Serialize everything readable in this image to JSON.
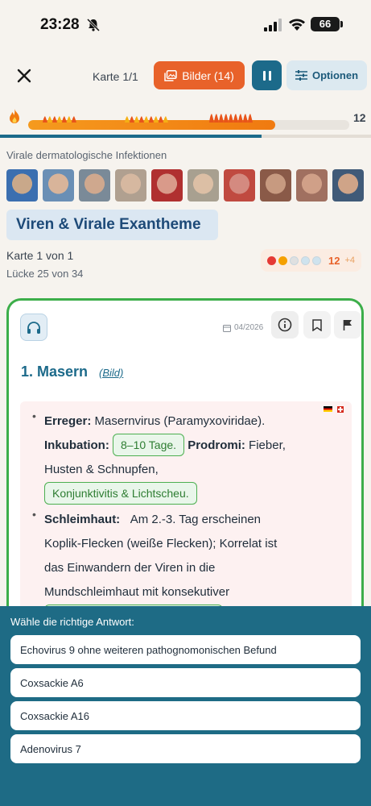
{
  "status_bar": {
    "time": "23:28",
    "battery": "66"
  },
  "toolbar": {
    "card_counter": "Karte 1/1",
    "images_label": "Bilder (14)",
    "options_label": "Optionen"
  },
  "progress": {
    "fraction": 0.77,
    "streak": "12",
    "fire_color": "#f07a10"
  },
  "category": {
    "label": "Virale dermatologische Infektionen",
    "image_count": 10
  },
  "topic": {
    "title": "Viren & Virale Exantheme"
  },
  "card_info": {
    "card_of": "Karte 1 von 1",
    "gap_of": "Lücke 25 von 34",
    "level": "12",
    "level_plus": "+4",
    "level_dots": [
      "#e53935",
      "#f5a000",
      "#e0e0e0",
      "#cfe3ee",
      "#cfe3ee"
    ]
  },
  "card": {
    "date": "04/2026",
    "entry_title": "1. Masern",
    "entry_link": "(Bild)",
    "bullet1": {
      "erreger_label": "Erreger:",
      "erreger_text": "Masernvirus (Paramyxoviridae).",
      "inkubation_label": "Inkubation:",
      "inkubation_pill": "8–10 Tage.",
      "prodromi_label": "Prodromi:",
      "prodromi_text": "Fieber,",
      "prodromi_text2": "Husten & Schnupfen,",
      "prodromi_pill": "Konjunktivitis & Lichtscheu."
    },
    "bullet2": {
      "label": "Schleimhaut:",
      "line1": "Am 2.-3. Tag erscheinen",
      "line2": "Koplik-Flecken (weiße Flecken); Korrelat ist",
      "line3": "das Einwandern der Viren in die",
      "line4": "Mundschleimhaut mit konsekutiver"
    }
  },
  "answers": {
    "prompt": "Wähle die richtige Antwort:",
    "options": [
      "Echovirus 9 ohne weiteren pathognomonischen Befund",
      "Coxsackie A6",
      "Coxsackie A16",
      "Adenovirus 7"
    ]
  },
  "colors": {
    "accent_orange": "#e8622a",
    "accent_teal": "#1c6a8a",
    "answer_panel": "#1e6b85",
    "card_border": "#3cae4a"
  }
}
